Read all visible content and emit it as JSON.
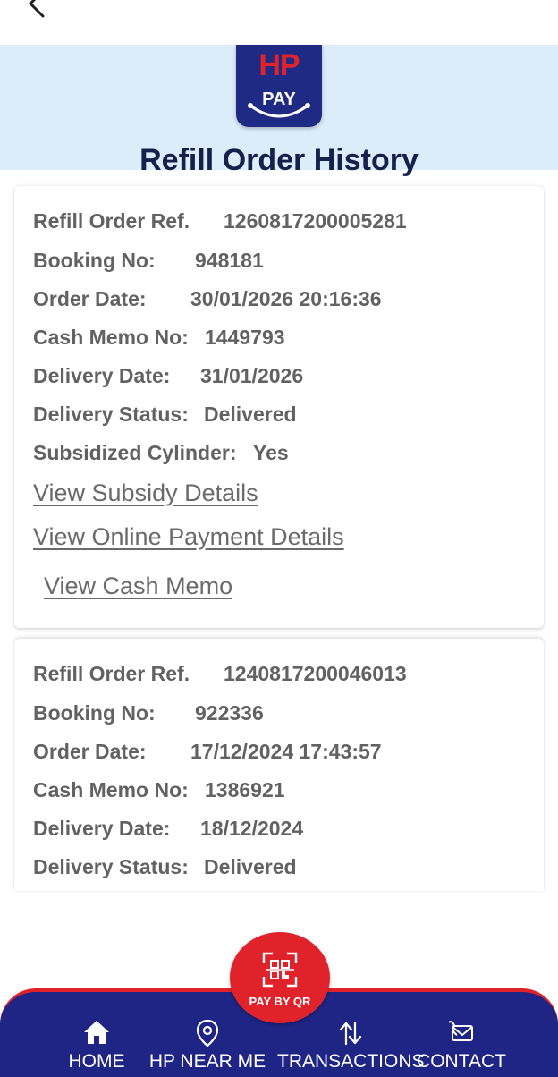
{
  "header": {
    "logo_top": "HP",
    "logo_bottom": "PAY",
    "title": "Refill Order History"
  },
  "labels": {
    "refill_ref": "Refill Order Ref.",
    "booking_no": "Booking No:",
    "order_date": "Order Date:",
    "cash_memo_no": "Cash Memo No:",
    "delivery_date": "Delivery Date:",
    "delivery_status": "Delivery Status:",
    "subsidized": "Subsidized Cylinder:"
  },
  "orders": [
    {
      "refill_ref": "1260817200005281",
      "booking_no": "948181",
      "order_date": "30/01/2026 20:16:36",
      "cash_memo_no": "1449793",
      "delivery_date": "31/01/2026",
      "delivery_status": "Delivered",
      "subsidized": "Yes",
      "links": {
        "subsidy": "View Subsidy Details",
        "payment": "View Online Payment Details",
        "cash_memo": "View Cash Memo"
      }
    },
    {
      "refill_ref": "1240817200046013",
      "booking_no": "922336",
      "order_date": "17/12/2024 17:43:57",
      "cash_memo_no": "1386921",
      "delivery_date": "18/12/2024",
      "delivery_status": "Delivered"
    }
  ],
  "qr_button": {
    "label": "PAY BY QR",
    "icon": "qr-scan-icon"
  },
  "nav": [
    {
      "label": "HOME",
      "icon": "home-icon"
    },
    {
      "label": "HP NEAR ME",
      "icon": "location-pin-icon"
    },
    {
      "label": "TRANSACTIONS",
      "icon": "transfer-arrows-icon"
    },
    {
      "label": "CONTACT",
      "icon": "phone-mail-icon"
    }
  ],
  "colors": {
    "header_bg": "#dcecf9",
    "title": "#15204d",
    "brand_blue": "#1e2585",
    "brand_red": "#e0232b",
    "text_gray": "#626262"
  }
}
